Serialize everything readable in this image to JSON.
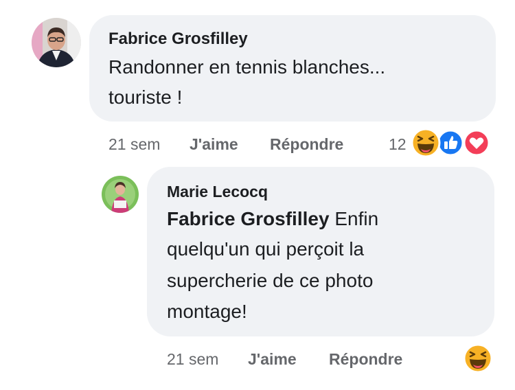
{
  "comment": {
    "author": "Fabrice Grosfilley",
    "text_lines": [
      "Randonner en tennis blanches...",
      "touriste !"
    ],
    "time": "21 sem",
    "like_label": "J'aime",
    "reply_label": "Répondre",
    "reaction_count": "12",
    "reactions": [
      "haha-icon",
      "like-icon",
      "love-icon"
    ]
  },
  "reply": {
    "author": "Marie Lecocq",
    "mention": "Fabrice Grosfilley",
    "text_lines": [
      " Enfin",
      "quelqu'un qui perçoit la",
      "supercherie de ce photo",
      "montage!"
    ],
    "time": "21 sem",
    "like_label": "J'aime",
    "reply_label": "Répondre",
    "reactions": [
      "haha-icon"
    ]
  }
}
